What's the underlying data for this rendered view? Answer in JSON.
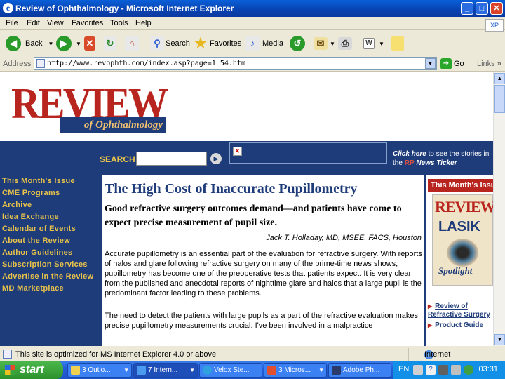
{
  "window": {
    "title": "Review of Ophthalmology - Microsoft Internet Explorer",
    "buttons": {
      "minimize": "_",
      "maximize": "□",
      "close": "✕"
    }
  },
  "menu": {
    "items": [
      "File",
      "Edit",
      "View",
      "Favorites",
      "Tools",
      "Help"
    ],
    "windows_flag": "XP"
  },
  "toolbar": {
    "back": "Back",
    "search": "Search",
    "favorites": "Favorites",
    "media": "Media"
  },
  "address": {
    "label": "Address",
    "url": "http://www.revophth.com/index.asp?page=1_54.htm",
    "go": "Go",
    "links": "Links",
    "links_chevron": "»"
  },
  "site": {
    "logo_main": "REVIEW",
    "logo_sub": "of Ophthalmology",
    "search_label": "SEARCH",
    "ticker_click": "Click here",
    "ticker_text_1": " to see the stories in the ",
    "ticker_rp": "RP",
    "ticker_text_2": " News Ticker",
    "nav": [
      "This Month's Issue",
      "CME Programs",
      "Archive",
      "Idea Exchange",
      "Calendar of Events",
      "About the Review",
      "Author Guidelines",
      "Subscription Services",
      "Advertise in the Review",
      "MD Marketplace"
    ]
  },
  "article": {
    "title": "The High Cost of Inaccurate Pupillometry",
    "subtitle": "Good refractive surgery outcomes demand—and patients have come to expect precise measurement of pupil size.",
    "author": "Jack T. Holladay, MD, MSEE, FACS, Houston",
    "p1": "Accurate pupillometry is an essential part of the evaluation for refractive surgery. With reports of halos and glare following refractive surgery on many of the prime-time news shows, pupillometry has become one of the preoperative tests that patients expect. It is very clear from the published and anecdotal reports of nighttime glare and halos that a large pupil is the predominant factor leading to these problems.",
    "p2": "The need to detect the patients with large pupils as a part of the refractive evaluation makes precise pupillometry measurements crucial. I've been involved in a malpractice"
  },
  "sidebar": {
    "heading": "This Month's Issue",
    "cover_logo": "REVIEW",
    "cover_title": "LASIK",
    "cover_sub": "Spotlight",
    "links": [
      "Review of Refractive Surgery",
      "Product Guide"
    ]
  },
  "status": {
    "text": "This site is optimized for MS Internet Explorer 4.0 or above",
    "zone": "Internet"
  },
  "taskbar": {
    "start": "start",
    "tasks": [
      "3 Outlo...",
      "7 Intern...",
      "Velox Ste...",
      "3 Micros...",
      "Adobe Ph..."
    ],
    "lang": "EN",
    "clock": "03:31"
  }
}
